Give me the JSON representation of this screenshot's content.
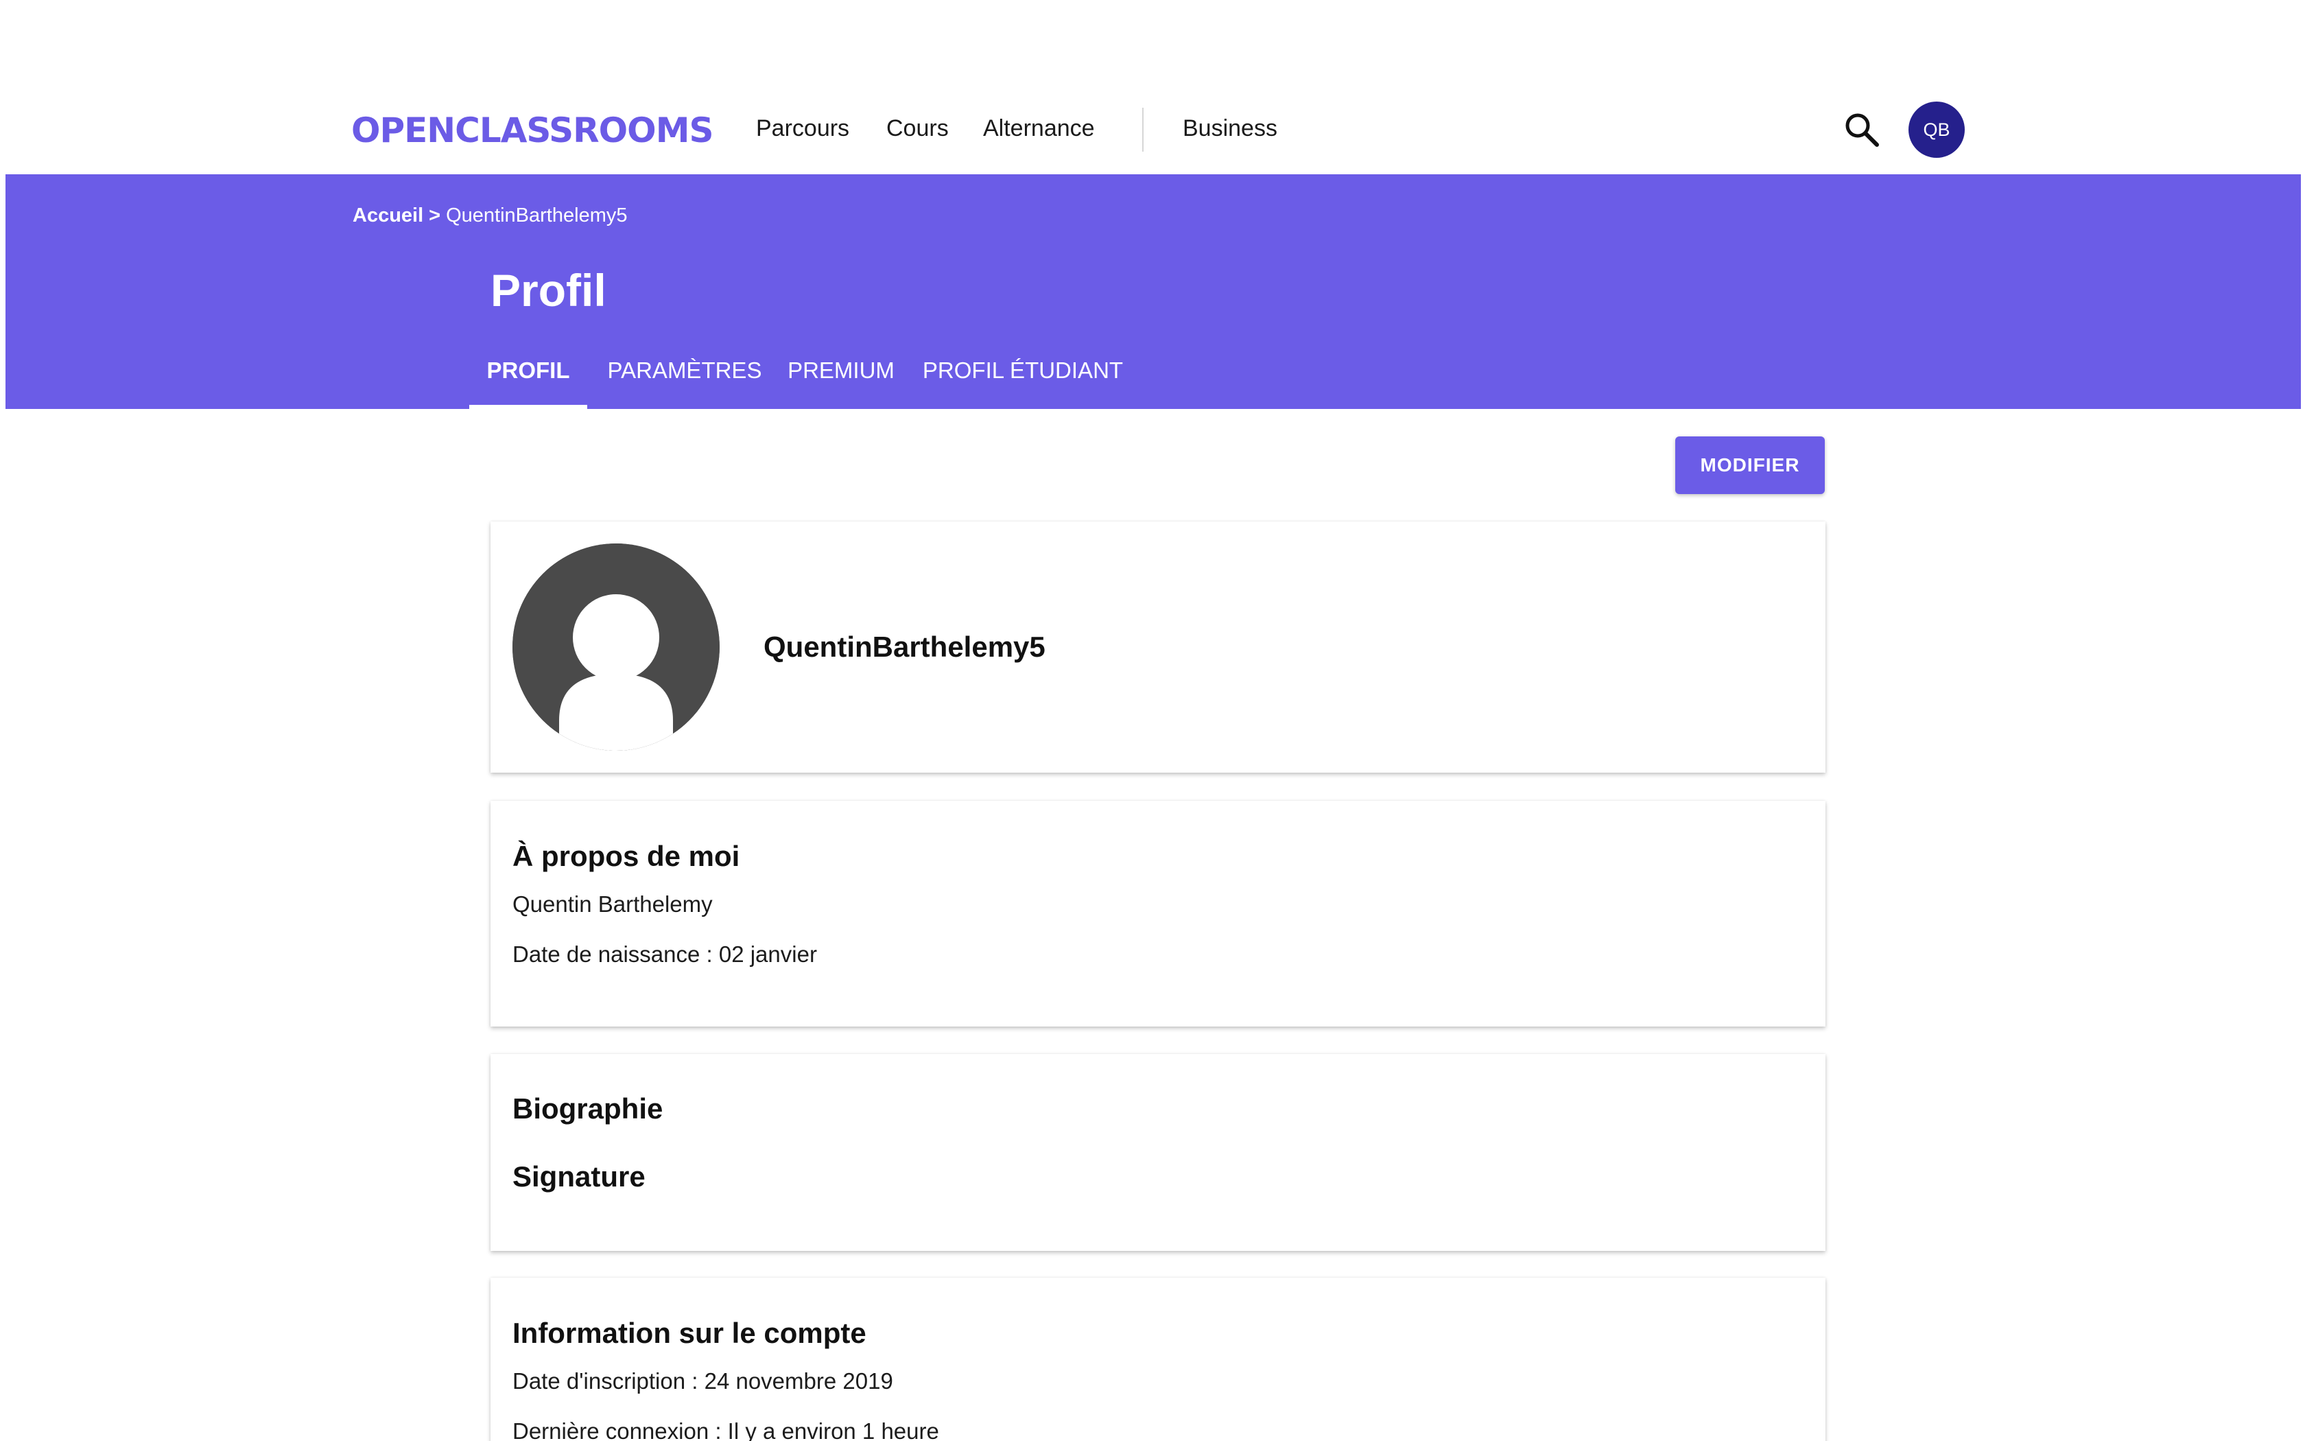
{
  "nav": {
    "logo_text": "OPENCLASSROOMS",
    "links": [
      "Parcours",
      "Cours",
      "Alternance"
    ],
    "business_link": "Business",
    "search_icon": "search-icon",
    "user_initials": "QB",
    "user_badge_color": "#25208c"
  },
  "header": {
    "breadcrumb_home": "Accueil",
    "breadcrumb_separator": ">",
    "breadcrumb_current": "QuentinBarthelemy5",
    "title": "Profil",
    "tabs": [
      "PROFIL",
      "PARAMÈTRES",
      "PREMIUM",
      "PROFIL ÉTUDIANT"
    ],
    "active_tab": "PROFIL",
    "accent_color": "#6b5ce7"
  },
  "actions": {
    "modify_label": "MODIFIER"
  },
  "profile": {
    "username": "QuentinBarthelemy5",
    "avatar_icon": "default-user-avatar-icon"
  },
  "about": {
    "heading": "À propos de moi",
    "full_name": "Quentin Barthelemy",
    "birthdate": "Date de naissance : 02 janvier"
  },
  "bio": {
    "biography_heading": "Biographie",
    "signature_heading": "Signature"
  },
  "account": {
    "heading": "Information sur le compte",
    "signup": "Date d'inscription : 24 novembre 2019",
    "last_login": "Dernière connexion : Il y a environ 1 heure"
  }
}
